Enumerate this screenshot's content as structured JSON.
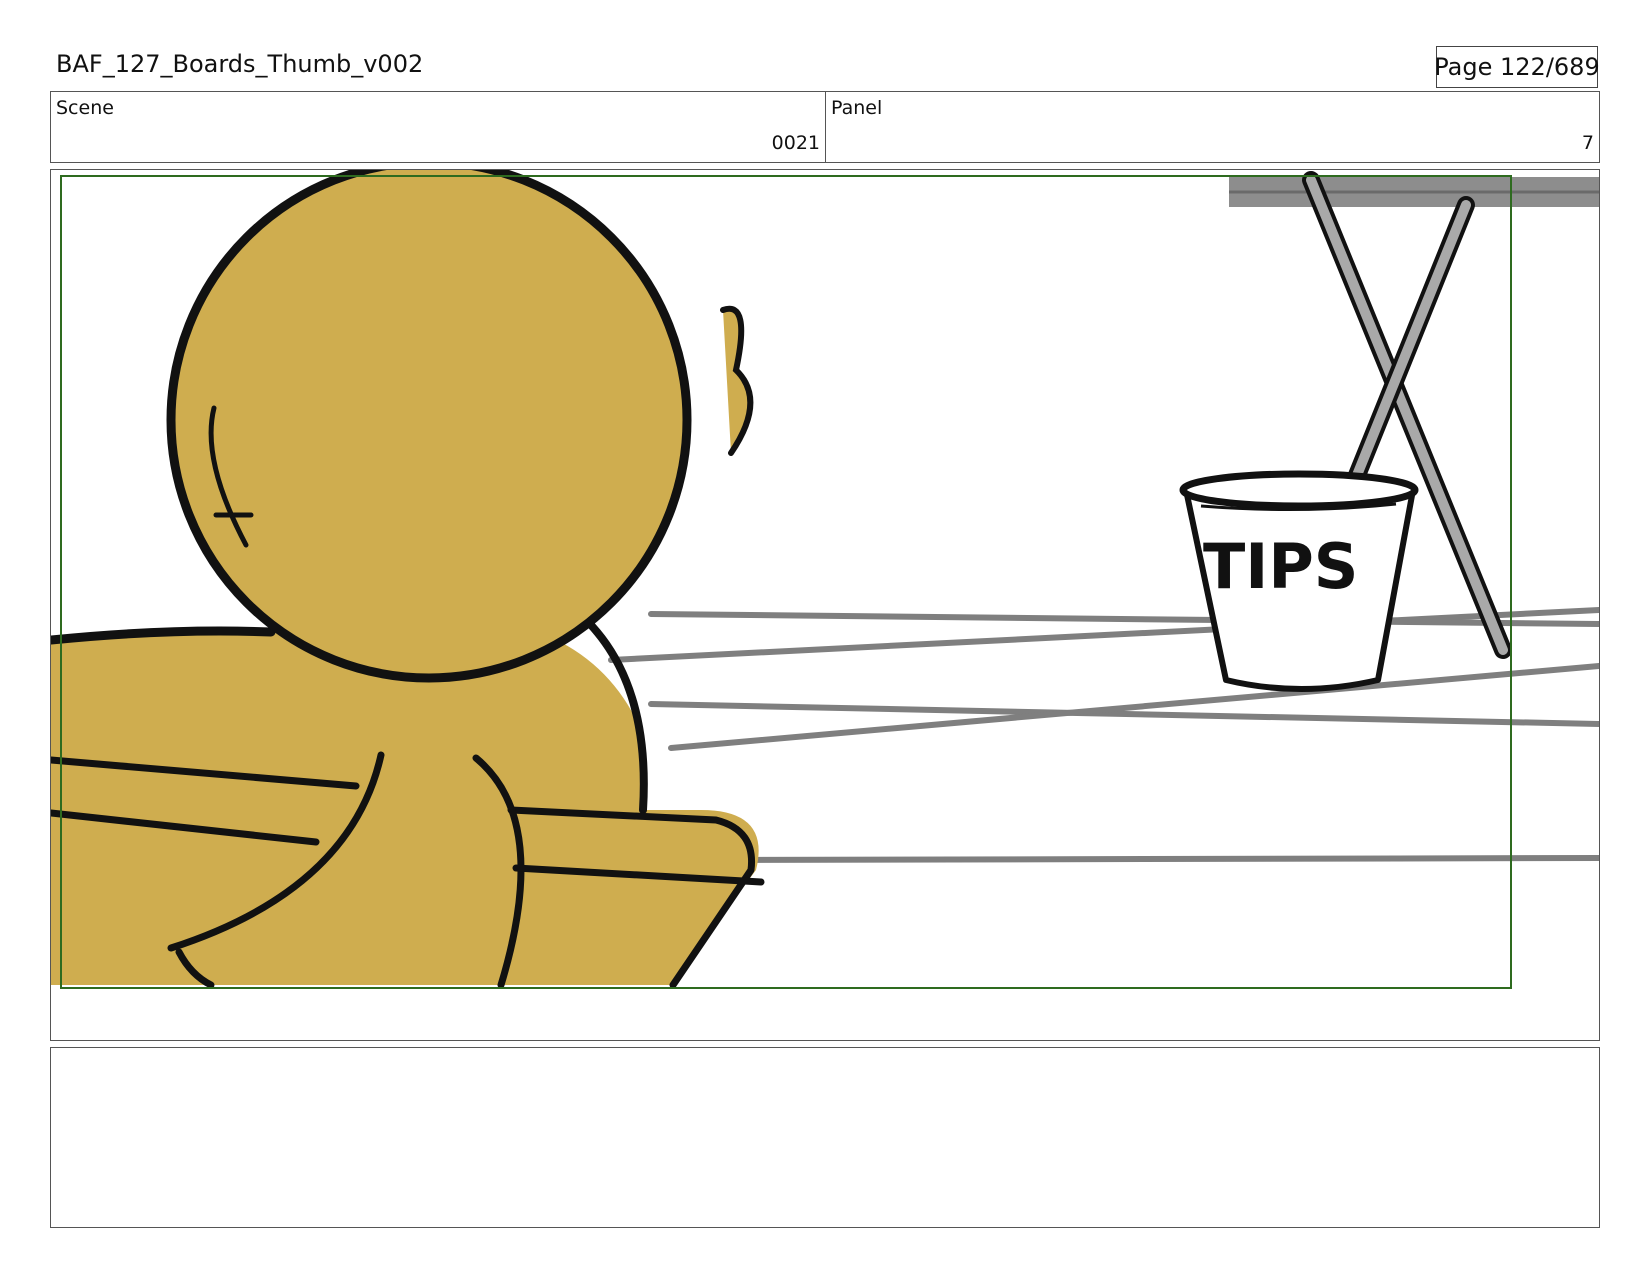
{
  "document": {
    "title": "BAF_127_Boards_Thumb_v002",
    "page": "Page 122/689"
  },
  "info": {
    "scene_label": "Scene",
    "scene_value": "0021",
    "panel_label": "Panel",
    "panel_value": "7"
  },
  "drawing": {
    "bucket_text": "TIPS",
    "skin_color": "#cfad4f",
    "safe_frame_color": "#2e6b1f",
    "floor_line_color": "#7f7f7f"
  },
  "notes": {
    "text": ""
  }
}
